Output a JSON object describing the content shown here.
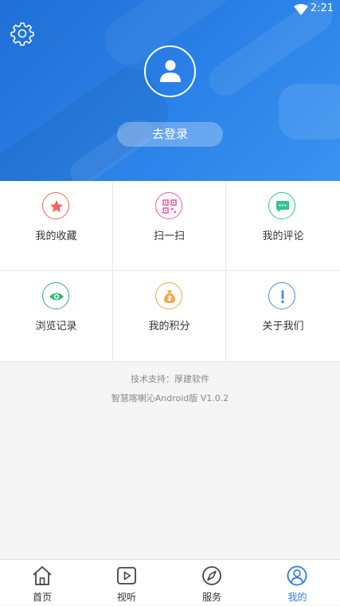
{
  "status_bar": {
    "time": "2:21"
  },
  "header": {
    "login_label": "去登录"
  },
  "menu": [
    {
      "label": "我的收藏",
      "icon": "star-icon",
      "color": "#f0655f"
    },
    {
      "label": "扫一扫",
      "icon": "qr-scan-icon",
      "color": "#e85ab0"
    },
    {
      "label": "我的评论",
      "icon": "comment-icon",
      "color": "#33c48a"
    },
    {
      "label": "浏览记录",
      "icon": "eye-icon",
      "color": "#2fb57a"
    },
    {
      "label": "我的积分",
      "icon": "money-bag-icon",
      "color": "#f5a447"
    },
    {
      "label": "关于我们",
      "icon": "info-exclamation-icon",
      "color": "#4f8fe8"
    }
  ],
  "footer": {
    "support": "技术支持：厚建软件",
    "version": "智慧喀喇沁Android版 V1.0.2"
  },
  "tabs": [
    {
      "label": "首页",
      "icon": "home-icon"
    },
    {
      "label": "视听",
      "icon": "play-icon"
    },
    {
      "label": "服务",
      "icon": "compass-icon"
    },
    {
      "label": "我的",
      "icon": "user-icon",
      "active": true
    }
  ],
  "colors": {
    "accent": "#2b7de3",
    "header_start": "#1f6fd6",
    "header_end": "#3a93f1"
  }
}
